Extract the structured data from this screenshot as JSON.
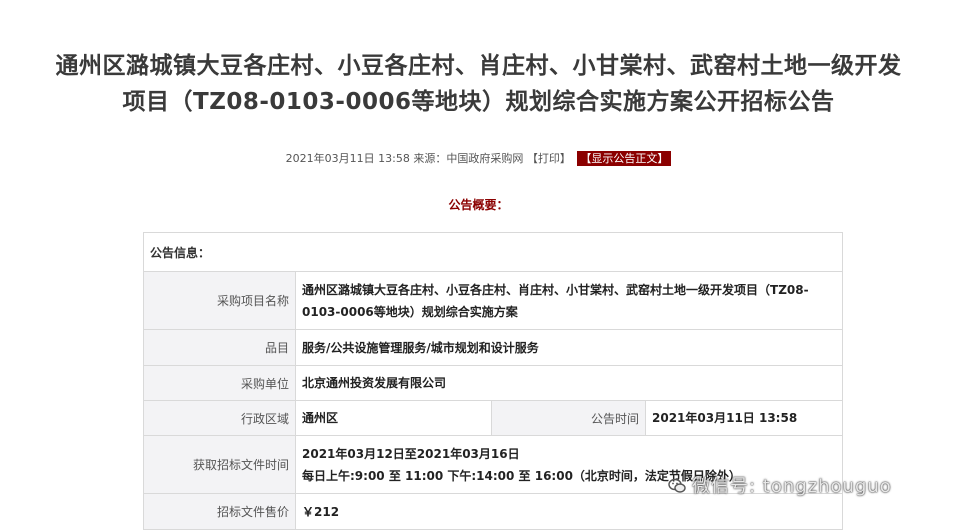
{
  "page": {
    "title_line1": "通州区潞城镇大豆各庄村、小豆各庄村、肖庄村、小甘棠村、武窑村土地一级开发",
    "title_line2": "项目（TZ08-0103-0006等地块）规划综合实施方案公开招标公告"
  },
  "meta": {
    "datetime": "2021年03月11日 13:58",
    "source": "来源：中国政府采购网",
    "print": "【打印】",
    "show_text": "【显示公告正文】"
  },
  "summary_heading": "公告概要：",
  "table": {
    "header": "公告信息：",
    "rows": {
      "project_label": "采购项目名称",
      "project_value": "通州区潞城镇大豆各庄村、小豆各庄村、肖庄村、小甘棠村、武窑村土地一级开发项目（TZ08-0103-0006等地块）规划综合实施方案",
      "item_label": "品目",
      "item_value": "服务/公共设施管理服务/城市规划和设计服务",
      "unit_label": "采购单位",
      "unit_value": "北京通州投资发展有限公司",
      "region_label": "行政区域",
      "region_value": "通州区",
      "time_label": "公告时间",
      "time_value": "2021年03月11日 13:58",
      "obtain_label": "获取招标文件时间",
      "obtain_value_1": "2021年03月12日至2021年03月16日",
      "obtain_value_2": "每日上午:9:00 至 11:00  下午:14:00 至 16:00（北京时间，法定节假日除外）",
      "price_label": "招标文件售价",
      "price_value": "￥212"
    }
  },
  "watermark": "微信号: tongzhouguo",
  "icons": {
    "watermark": "wechat-icon"
  }
}
